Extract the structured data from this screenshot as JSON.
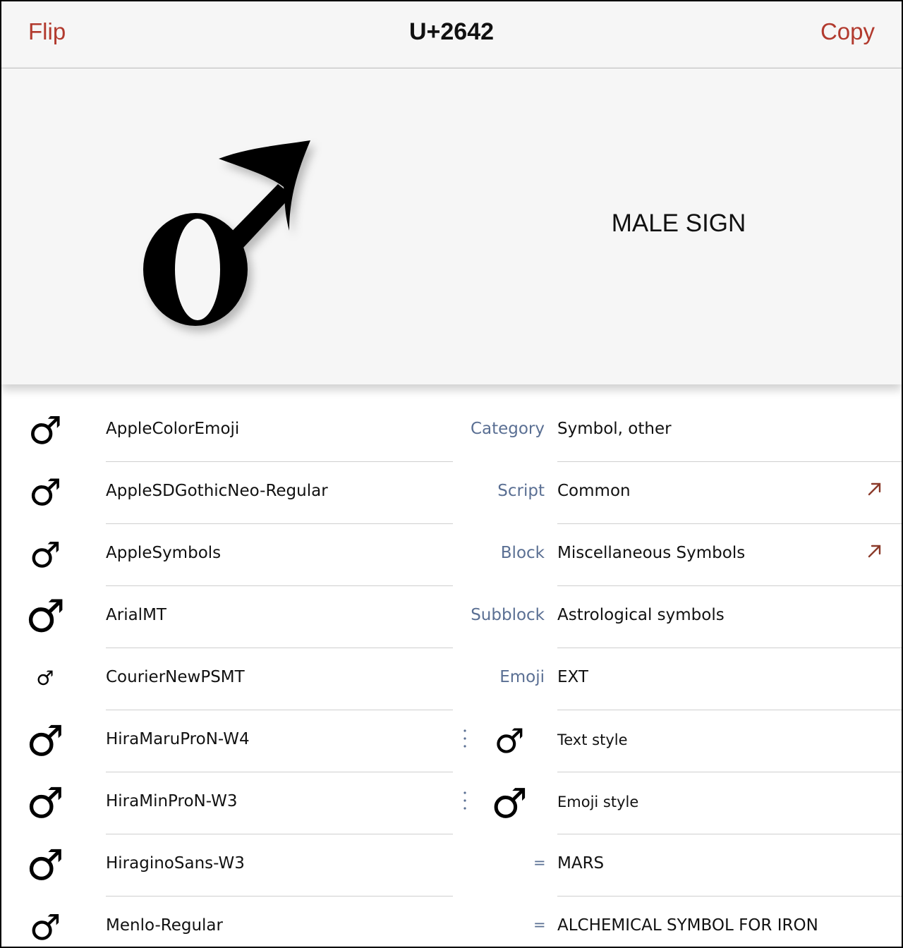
{
  "header": {
    "flip_label": "Flip",
    "title": "U+2642",
    "copy_label": "Copy"
  },
  "hero": {
    "glyph": "♂",
    "name": "MALE SIGN"
  },
  "fonts": [
    {
      "glyph": "♂",
      "name": "AppleColorEmoji"
    },
    {
      "glyph": "♂",
      "name": "AppleSDGothicNeo-Regular"
    },
    {
      "glyph": "♂",
      "name": "AppleSymbols"
    },
    {
      "glyph": "♂",
      "name": "ArialMT"
    },
    {
      "glyph": "♂",
      "name": "CourierNewPSMT"
    },
    {
      "glyph": "♂",
      "name": "HiraMaruProN-W4"
    },
    {
      "glyph": "♂",
      "name": "HiraMinProN-W3"
    },
    {
      "glyph": "♂",
      "name": "HiraginoSans-W3"
    },
    {
      "glyph": "♂",
      "name": "Menlo-Regular"
    }
  ],
  "properties": [
    {
      "label": "Category",
      "value": "Symbol, other"
    },
    {
      "label": "Script",
      "value": "Common"
    },
    {
      "label": "Block",
      "value": "Miscellaneous Symbols"
    },
    {
      "label": "Subblock",
      "value": "Astrological symbols"
    },
    {
      "label": "Emoji",
      "value": "EXT"
    }
  ],
  "styles": [
    {
      "glyph": "♂",
      "label": "Text style"
    },
    {
      "glyph": "♂",
      "label": "Emoji style"
    }
  ],
  "aliases": [
    {
      "symbol": "=",
      "value": "MARS"
    },
    {
      "symbol": "=",
      "value": "ALCHEMICAL SYMBOL FOR IRON"
    }
  ],
  "colors": {
    "accent": "#b23a2e",
    "label": "#5a6f93",
    "arrow": "#8b3a2a"
  }
}
